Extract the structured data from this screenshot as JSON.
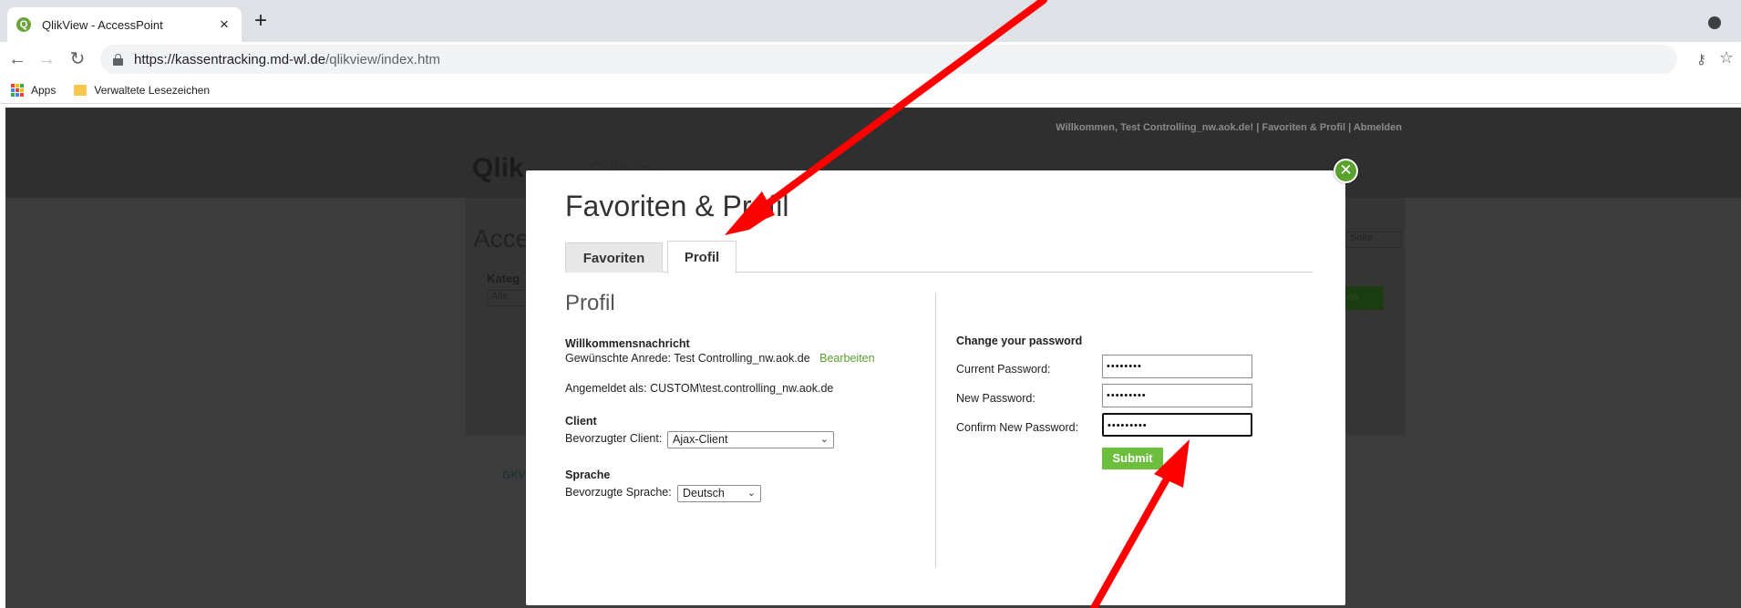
{
  "browser": {
    "tab_title": "QlikView - AccessPoint",
    "tab_close": "×",
    "new_tab": "+",
    "url_host": "https://kassentracking.md-wl.de",
    "url_path": "/qlikview/index.htm",
    "bookmarks": [
      {
        "label": "Apps"
      },
      {
        "label": "Verwaltete Lesezeichen"
      }
    ]
  },
  "background_page": {
    "welcome_text": "Willkommen, Test Controlling_nw.aok.de! | Favoriten & Profil | Abmelden",
    "logo_qlik": "Qlik",
    "logo_product": "QlikView",
    "heading_partial": "Acce",
    "category_label_partial": "Kateg",
    "category_value": "Alle",
    "select_partial": "Seite",
    "button_partial": "en",
    "link_partial": "GKV"
  },
  "modal": {
    "title": "Favoriten & Profil",
    "close_icon": "✕",
    "tabs": [
      {
        "label": "Favoriten",
        "active": false
      },
      {
        "label": "Profil",
        "active": true
      }
    ],
    "profile": {
      "heading": "Profil",
      "welcome_heading": "Willkommensnachricht",
      "greeting_label": "Gewünschte Anrede: Test Controlling_nw.aok.de",
      "edit_link": "Bearbeiten",
      "logged_in_as": "Angemeldet als: CUSTOM\\test.controlling_nw.aok.de",
      "client_heading": "Client",
      "client_label": "Bevorzugter Client:",
      "client_value": "Ajax-Client",
      "language_heading": "Sprache",
      "language_label": "Bevorzugte Sprache:",
      "language_value": "Deutsch"
    },
    "password": {
      "heading": "Change your password",
      "current_label": "Current Password:",
      "current_value": "••••••••",
      "new_label": "New Password:",
      "new_value": "•••••••••",
      "confirm_label": "Confirm New Password:",
      "confirm_value": "•••••••••",
      "submit_label": "Submit"
    }
  },
  "colors": {
    "accent_green": "#6cbf3d",
    "arrow_red": "#ff0000"
  }
}
